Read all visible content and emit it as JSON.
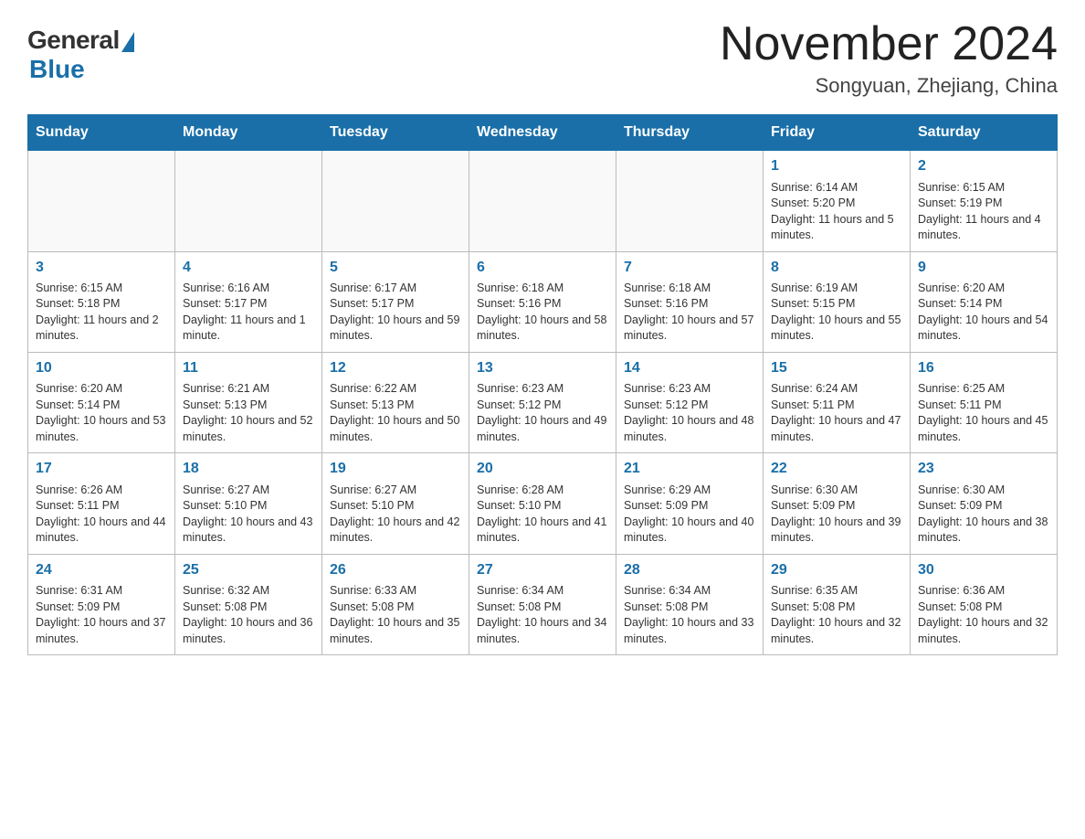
{
  "header": {
    "logo_general": "General",
    "logo_blue": "Blue",
    "month_title": "November 2024",
    "subtitle": "Songyuan, Zhejiang, China"
  },
  "weekdays": [
    "Sunday",
    "Monday",
    "Tuesday",
    "Wednesday",
    "Thursday",
    "Friday",
    "Saturday"
  ],
  "weeks": [
    [
      {
        "day": "",
        "info": ""
      },
      {
        "day": "",
        "info": ""
      },
      {
        "day": "",
        "info": ""
      },
      {
        "day": "",
        "info": ""
      },
      {
        "day": "",
        "info": ""
      },
      {
        "day": "1",
        "info": "Sunrise: 6:14 AM\nSunset: 5:20 PM\nDaylight: 11 hours and 5 minutes."
      },
      {
        "day": "2",
        "info": "Sunrise: 6:15 AM\nSunset: 5:19 PM\nDaylight: 11 hours and 4 minutes."
      }
    ],
    [
      {
        "day": "3",
        "info": "Sunrise: 6:15 AM\nSunset: 5:18 PM\nDaylight: 11 hours and 2 minutes."
      },
      {
        "day": "4",
        "info": "Sunrise: 6:16 AM\nSunset: 5:17 PM\nDaylight: 11 hours and 1 minute."
      },
      {
        "day": "5",
        "info": "Sunrise: 6:17 AM\nSunset: 5:17 PM\nDaylight: 10 hours and 59 minutes."
      },
      {
        "day": "6",
        "info": "Sunrise: 6:18 AM\nSunset: 5:16 PM\nDaylight: 10 hours and 58 minutes."
      },
      {
        "day": "7",
        "info": "Sunrise: 6:18 AM\nSunset: 5:16 PM\nDaylight: 10 hours and 57 minutes."
      },
      {
        "day": "8",
        "info": "Sunrise: 6:19 AM\nSunset: 5:15 PM\nDaylight: 10 hours and 55 minutes."
      },
      {
        "day": "9",
        "info": "Sunrise: 6:20 AM\nSunset: 5:14 PM\nDaylight: 10 hours and 54 minutes."
      }
    ],
    [
      {
        "day": "10",
        "info": "Sunrise: 6:20 AM\nSunset: 5:14 PM\nDaylight: 10 hours and 53 minutes."
      },
      {
        "day": "11",
        "info": "Sunrise: 6:21 AM\nSunset: 5:13 PM\nDaylight: 10 hours and 52 minutes."
      },
      {
        "day": "12",
        "info": "Sunrise: 6:22 AM\nSunset: 5:13 PM\nDaylight: 10 hours and 50 minutes."
      },
      {
        "day": "13",
        "info": "Sunrise: 6:23 AM\nSunset: 5:12 PM\nDaylight: 10 hours and 49 minutes."
      },
      {
        "day": "14",
        "info": "Sunrise: 6:23 AM\nSunset: 5:12 PM\nDaylight: 10 hours and 48 minutes."
      },
      {
        "day": "15",
        "info": "Sunrise: 6:24 AM\nSunset: 5:11 PM\nDaylight: 10 hours and 47 minutes."
      },
      {
        "day": "16",
        "info": "Sunrise: 6:25 AM\nSunset: 5:11 PM\nDaylight: 10 hours and 45 minutes."
      }
    ],
    [
      {
        "day": "17",
        "info": "Sunrise: 6:26 AM\nSunset: 5:11 PM\nDaylight: 10 hours and 44 minutes."
      },
      {
        "day": "18",
        "info": "Sunrise: 6:27 AM\nSunset: 5:10 PM\nDaylight: 10 hours and 43 minutes."
      },
      {
        "day": "19",
        "info": "Sunrise: 6:27 AM\nSunset: 5:10 PM\nDaylight: 10 hours and 42 minutes."
      },
      {
        "day": "20",
        "info": "Sunrise: 6:28 AM\nSunset: 5:10 PM\nDaylight: 10 hours and 41 minutes."
      },
      {
        "day": "21",
        "info": "Sunrise: 6:29 AM\nSunset: 5:09 PM\nDaylight: 10 hours and 40 minutes."
      },
      {
        "day": "22",
        "info": "Sunrise: 6:30 AM\nSunset: 5:09 PM\nDaylight: 10 hours and 39 minutes."
      },
      {
        "day": "23",
        "info": "Sunrise: 6:30 AM\nSunset: 5:09 PM\nDaylight: 10 hours and 38 minutes."
      }
    ],
    [
      {
        "day": "24",
        "info": "Sunrise: 6:31 AM\nSunset: 5:09 PM\nDaylight: 10 hours and 37 minutes."
      },
      {
        "day": "25",
        "info": "Sunrise: 6:32 AM\nSunset: 5:08 PM\nDaylight: 10 hours and 36 minutes."
      },
      {
        "day": "26",
        "info": "Sunrise: 6:33 AM\nSunset: 5:08 PM\nDaylight: 10 hours and 35 minutes."
      },
      {
        "day": "27",
        "info": "Sunrise: 6:34 AM\nSunset: 5:08 PM\nDaylight: 10 hours and 34 minutes."
      },
      {
        "day": "28",
        "info": "Sunrise: 6:34 AM\nSunset: 5:08 PM\nDaylight: 10 hours and 33 minutes."
      },
      {
        "day": "29",
        "info": "Sunrise: 6:35 AM\nSunset: 5:08 PM\nDaylight: 10 hours and 32 minutes."
      },
      {
        "day": "30",
        "info": "Sunrise: 6:36 AM\nSunset: 5:08 PM\nDaylight: 10 hours and 32 minutes."
      }
    ]
  ]
}
